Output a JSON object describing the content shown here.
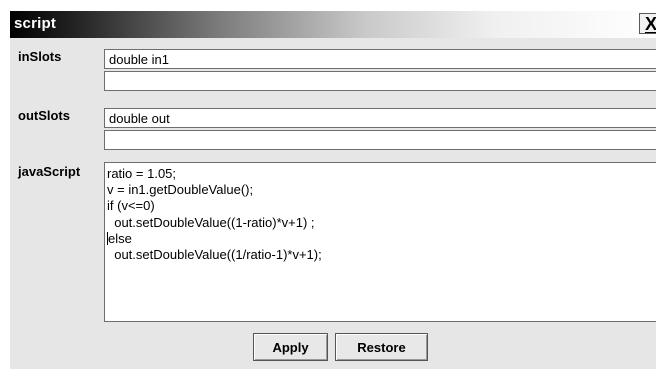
{
  "window": {
    "title": "script",
    "close_label": "X"
  },
  "inSlots": {
    "label": "inSlots",
    "values": [
      "double in1",
      ""
    ]
  },
  "outSlots": {
    "label": "outSlots",
    "values": [
      "double out",
      ""
    ]
  },
  "javaScript": {
    "label": "javaScript",
    "lines": [
      "ratio = 1.05;",
      "v = in1.getDoubleValue();",
      "if (v<=0)",
      "  out.setDoubleValue((1-ratio)*v+1) ;",
      "else",
      "  out.setDoubleValue((1/ratio-1)*v+1);"
    ]
  },
  "buttons": {
    "apply": "Apply",
    "restore": "Restore"
  }
}
